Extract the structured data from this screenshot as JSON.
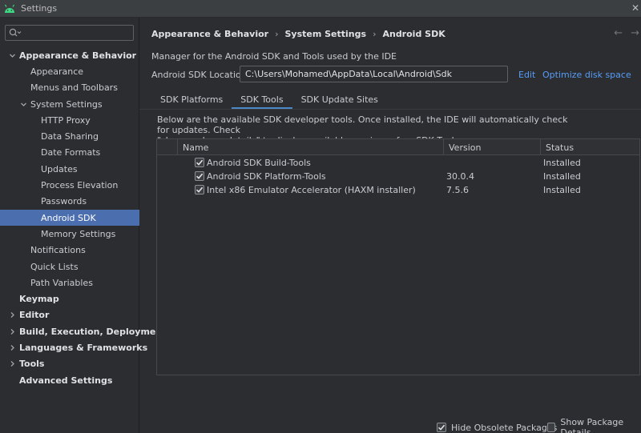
{
  "window": {
    "title": "Settings",
    "close_glyph": "✕"
  },
  "sidebar": {
    "search": {
      "placeholder": ""
    },
    "items": [
      {
        "label": "Appearance & Behavior",
        "level": 0,
        "bold": true,
        "chevron": "down",
        "selected": false
      },
      {
        "label": "Appearance",
        "level": 1,
        "bold": false,
        "chevron": "",
        "selected": false
      },
      {
        "label": "Menus and Toolbars",
        "level": 1,
        "bold": false,
        "chevron": "",
        "selected": false
      },
      {
        "label": "System Settings",
        "level": 1,
        "bold": false,
        "chevron": "down",
        "selected": false
      },
      {
        "label": "HTTP Proxy",
        "level": 2,
        "bold": false,
        "chevron": "",
        "selected": false
      },
      {
        "label": "Data Sharing",
        "level": 2,
        "bold": false,
        "chevron": "",
        "selected": false
      },
      {
        "label": "Date Formats",
        "level": 2,
        "bold": false,
        "chevron": "",
        "selected": false
      },
      {
        "label": "Updates",
        "level": 2,
        "bold": false,
        "chevron": "",
        "selected": false
      },
      {
        "label": "Process Elevation",
        "level": 2,
        "bold": false,
        "chevron": "",
        "selected": false
      },
      {
        "label": "Passwords",
        "level": 2,
        "bold": false,
        "chevron": "",
        "selected": false
      },
      {
        "label": "Android SDK",
        "level": 2,
        "bold": false,
        "chevron": "",
        "selected": true
      },
      {
        "label": "Memory Settings",
        "level": 2,
        "bold": false,
        "chevron": "",
        "selected": false
      },
      {
        "label": "Notifications",
        "level": 1,
        "bold": false,
        "chevron": "",
        "selected": false
      },
      {
        "label": "Quick Lists",
        "level": 1,
        "bold": false,
        "chevron": "",
        "selected": false
      },
      {
        "label": "Path Variables",
        "level": 1,
        "bold": false,
        "chevron": "",
        "selected": false
      },
      {
        "label": "Keymap",
        "level": 0,
        "bold": true,
        "chevron": "",
        "selected": false
      },
      {
        "label": "Editor",
        "level": 0,
        "bold": true,
        "chevron": "right",
        "selected": false
      },
      {
        "label": "Build, Execution, Deployment",
        "level": 0,
        "bold": true,
        "chevron": "right",
        "selected": false
      },
      {
        "label": "Languages & Frameworks",
        "level": 0,
        "bold": true,
        "chevron": "right",
        "selected": false
      },
      {
        "label": "Tools",
        "level": 0,
        "bold": true,
        "chevron": "right",
        "selected": false
      },
      {
        "label": "Advanced Settings",
        "level": 0,
        "bold": true,
        "chevron": "",
        "selected": false
      }
    ]
  },
  "header": {
    "breadcrumb": [
      "Appearance & Behavior",
      "System Settings",
      "Android SDK"
    ],
    "back_glyph": "←",
    "forward_glyph": "→"
  },
  "main": {
    "description": "Manager for the Android SDK and Tools used by the IDE",
    "sdk_location_label": "Android SDK Location:",
    "sdk_location_value": "C:\\Users\\Mohamed\\AppData\\Local\\Android\\Sdk",
    "edit_link": "Edit",
    "optimize_link": "Optimize disk space",
    "tabs": [
      {
        "label": "SDK Platforms",
        "active": false
      },
      {
        "label": "SDK Tools",
        "active": true
      },
      {
        "label": "SDK Update Sites",
        "active": false
      }
    ],
    "info_line1": "Below are the available SDK developer tools. Once installed, the IDE will automatically check for updates. Check",
    "info_line2": "\"show package details\" to display available versions of an SDK Tool.",
    "table": {
      "columns": [
        "Name",
        "Version",
        "Status"
      ],
      "rows": [
        {
          "checked": true,
          "name": "Android SDK Build-Tools",
          "version": "",
          "status": "Installed"
        },
        {
          "checked": true,
          "name": "Android SDK Platform-Tools",
          "version": "30.0.4",
          "status": "Installed"
        },
        {
          "checked": true,
          "name": "Intel x86 Emulator Accelerator (HAXM installer)",
          "version": "7.5.6",
          "status": "Installed"
        }
      ]
    },
    "footer": {
      "hide_obsolete_label": "Hide Obsolete Packages",
      "hide_obsolete_checked": true,
      "show_details_label": "Show Package Details",
      "show_details_checked": false
    }
  },
  "colors": {
    "background": "#2b2d30",
    "selection": "#4b6eaf",
    "link": "#589df6",
    "tab_underline": "#4a88c7",
    "android_green": "#3ddc84"
  }
}
